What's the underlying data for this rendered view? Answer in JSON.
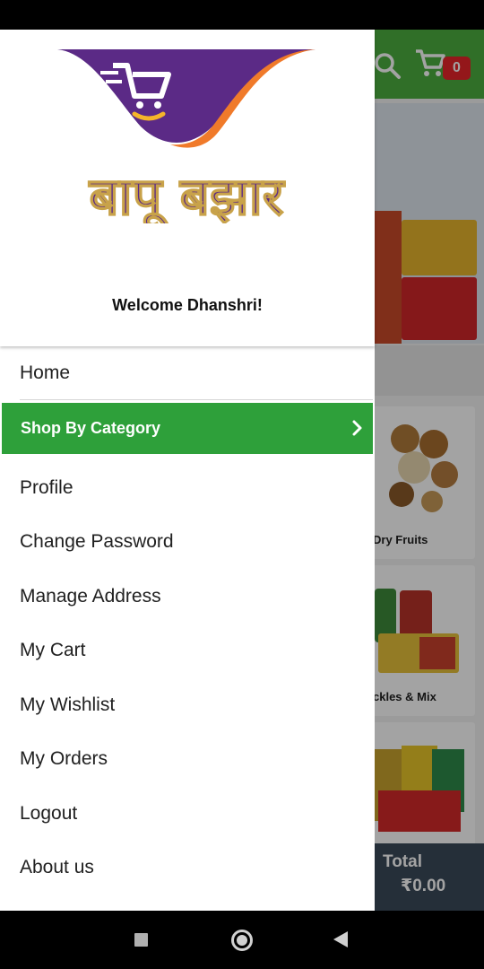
{
  "background": {
    "cart_count": "0",
    "categories": [
      {
        "label": "Dry Fruits"
      },
      {
        "label": "ckles & Mix"
      },
      {
        "label": ""
      }
    ],
    "total_label": "Total",
    "total_value": "₹0.00"
  },
  "drawer": {
    "welcome_text": "Welcome Dhanshri!",
    "logo_text": "बापू बझार",
    "menu": {
      "home": "Home",
      "shop_by_category": "Shop By Category",
      "profile": "Profile",
      "change_password": "Change Password",
      "manage_address": "Manage Address",
      "my_cart": "My Cart",
      "my_wishlist": "My Wishlist",
      "my_orders": "My Orders",
      "logout": "Logout",
      "about_us": "About us"
    }
  },
  "colors": {
    "primary_green": "#2ea03a",
    "logo_purple": "#5b2a86",
    "logo_orange": "#f07a2a",
    "cart_badge": "#e8252a"
  }
}
